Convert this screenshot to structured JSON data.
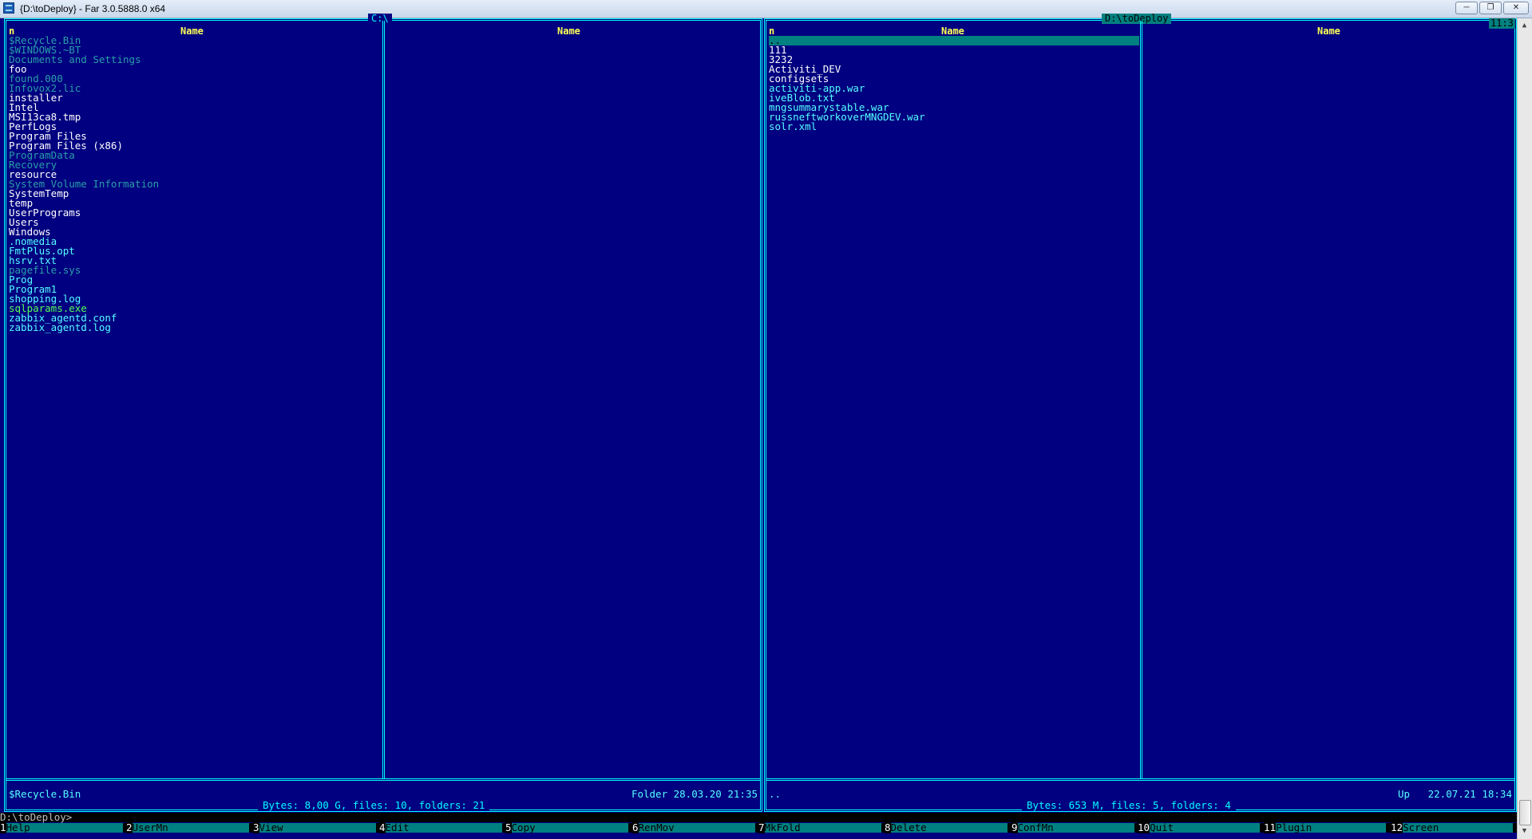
{
  "window": {
    "title": "{D:\\toDeploy} - Far 3.0.5888.0 x64"
  },
  "clock": "11:3",
  "left_panel": {
    "path": " C:\\ ",
    "col_n": "n",
    "col_name_1": "Name",
    "col_name_2": "Name",
    "files": [
      {
        "name": "$Recycle.Bin",
        "type": "hidden"
      },
      {
        "name": "$WINDOWS.~BT",
        "type": "hidden"
      },
      {
        "name": "Documents and Settings",
        "type": "hidden"
      },
      {
        "name": "foo",
        "type": "dir"
      },
      {
        "name": "found.000",
        "type": "hidden"
      },
      {
        "name": "Infovox2.lic",
        "type": "hidden"
      },
      {
        "name": "installer",
        "type": "dir"
      },
      {
        "name": "Intel",
        "type": "dir"
      },
      {
        "name": "MSI13ca8.tmp",
        "type": "dir"
      },
      {
        "name": "PerfLogs",
        "type": "dir"
      },
      {
        "name": "Program Files",
        "type": "dir"
      },
      {
        "name": "Program Files (x86)",
        "type": "dir"
      },
      {
        "name": "ProgramData",
        "type": "hidden"
      },
      {
        "name": "Recovery",
        "type": "hidden"
      },
      {
        "name": "resource",
        "type": "dir"
      },
      {
        "name": "System Volume Information",
        "type": "hidden"
      },
      {
        "name": "SystemTemp",
        "type": "dir"
      },
      {
        "name": "temp",
        "type": "dir"
      },
      {
        "name": "UserPrograms",
        "type": "dir"
      },
      {
        "name": "Users",
        "type": "dir"
      },
      {
        "name": "Windows",
        "type": "dir"
      },
      {
        "name": ".nomedia",
        "type": "file"
      },
      {
        "name": "FmtPlus.opt",
        "type": "file"
      },
      {
        "name": "hsrv.txt",
        "type": "file"
      },
      {
        "name": "pagefile.sys",
        "type": "hidden"
      },
      {
        "name": "Prog",
        "type": "file"
      },
      {
        "name": "Program1",
        "type": "file"
      },
      {
        "name": "shopping.log",
        "type": "file"
      },
      {
        "name": "sqlparams.exe",
        "type": "exe"
      },
      {
        "name": "zabbix_agentd.conf",
        "type": "file"
      },
      {
        "name": "zabbix_agentd.log",
        "type": "file"
      }
    ],
    "status_name": "$Recycle.Bin",
    "status_info": "Folder 28.03.20 21:35",
    "totals": "Bytes: 8,00 G, files: 10, folders: 21"
  },
  "right_panel": {
    "path": " D:\\toDeploy ",
    "col_n": "n",
    "col_name_1": "Name",
    "col_name_2": "Name",
    "files": [
      {
        "name": "..",
        "type": "sel"
      },
      {
        "name": "111",
        "type": "dir"
      },
      {
        "name": "3232",
        "type": "dir"
      },
      {
        "name": "Activiti_DEV",
        "type": "dir"
      },
      {
        "name": "configsets",
        "type": "dir"
      },
      {
        "name": "activiti-app.war",
        "type": "file"
      },
      {
        "name": "iveBlob.txt",
        "type": "file"
      },
      {
        "name": "mngsummarystable.war",
        "type": "file"
      },
      {
        "name": "russneftworkoverMNGDEV.war",
        "type": "file"
      },
      {
        "name": "solr.xml",
        "type": "file"
      }
    ],
    "status_name": "..",
    "status_info": "Up   22.07.21 18:34",
    "totals": "Bytes: 653 M, files: 5, folders: 4"
  },
  "command_line": "D:\\toDeploy>",
  "keybar": [
    {
      "num": "1",
      "label": "Help"
    },
    {
      "num": "2",
      "label": "UserMn"
    },
    {
      "num": "3",
      "label": "View"
    },
    {
      "num": "4",
      "label": "Edit"
    },
    {
      "num": "5",
      "label": "Copy"
    },
    {
      "num": "6",
      "label": "RenMov"
    },
    {
      "num": "7",
      "label": "MkFold"
    },
    {
      "num": "8",
      "label": "Delete"
    },
    {
      "num": "9",
      "label": "ConfMn"
    },
    {
      "num": "10",
      "label": "Quit"
    },
    {
      "num": "11",
      "label": "Plugin"
    },
    {
      "num": "12",
      "label": "Screen"
    }
  ]
}
